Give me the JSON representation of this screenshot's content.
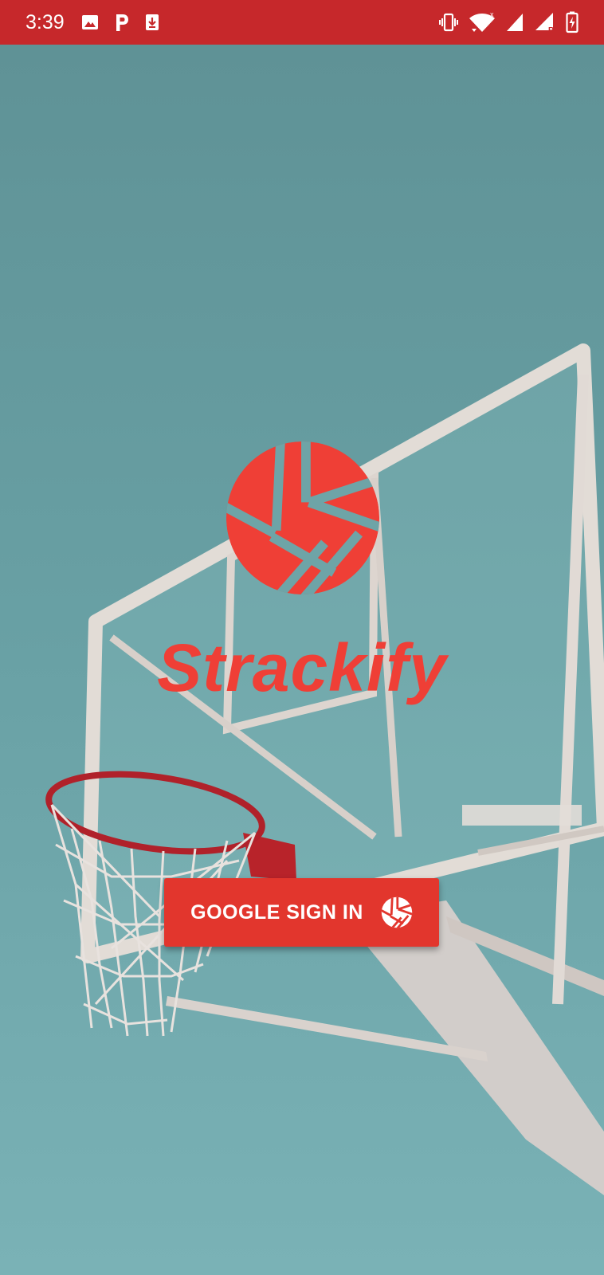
{
  "status_bar": {
    "time": "3:39",
    "background": "#c6282b",
    "left_icons": [
      "image-icon",
      "parking-icon",
      "download-icon"
    ],
    "right_icons": [
      "vibrate-icon",
      "wifi-icon",
      "cell-signal-icon",
      "cell-signal-roaming-icon",
      "battery-charging-icon"
    ]
  },
  "app": {
    "name": "Strackify",
    "logo_icon": "strackify-ball-logo",
    "accent_color": "#ef3f36"
  },
  "signin": {
    "label": "GOOGLE SIGN IN",
    "icon": "strackify-ball-icon",
    "background": "#e2362d"
  },
  "background_scene": {
    "description_icon": "basketball-hoop-image",
    "sky_color": "#6aa0a2"
  }
}
